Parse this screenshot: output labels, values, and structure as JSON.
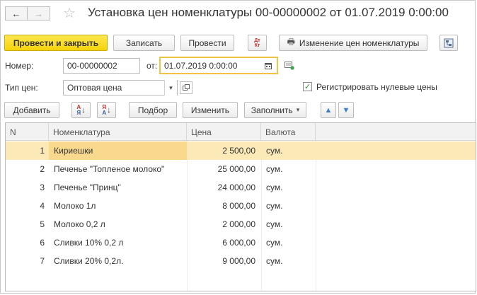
{
  "window": {
    "title": "Установка цен номенклатуры 00-00000002 от 01.07.2019 0:00:00",
    "nav": {
      "back": "←",
      "forward": "→"
    },
    "favorite_icon": "star-icon"
  },
  "toolbar": {
    "post_close": "Провести и закрыть",
    "save": "Записать",
    "post": "Провести",
    "dtkt_top": "Дт",
    "dtkt_bottom": "Кт",
    "print_label": "Изменение цен номенклатуры"
  },
  "form": {
    "number_label": "Номер:",
    "number_value": "00-00000002",
    "date_label": "от:",
    "date_value": "01.07.2019  0:00:00",
    "price_type_label": "Тип цен:",
    "price_type_value": "Оптовая цена",
    "zero_prices_label": "Регистрировать нулевые цены",
    "zero_prices_checked": true
  },
  "table_toolbar": {
    "add": "Добавить",
    "sort_asc_top": "А",
    "sort_asc_bottom": "Я",
    "sort_desc_top": "Я",
    "sort_desc_bottom": "А",
    "select": "Подбор",
    "change": "Изменить",
    "fill": "Заполнить",
    "fill_arrow": "▾",
    "up": "▲",
    "down": "▼"
  },
  "table": {
    "columns": [
      "N",
      "Номенклатура",
      "Цена",
      "Валюта"
    ],
    "rows": [
      {
        "n": "1",
        "name": "Кириешки",
        "price": "2 500,00",
        "currency": "сум."
      },
      {
        "n": "2",
        "name": "Печенье \"Топленое молоко\"",
        "price": "25 000,00",
        "currency": "сум."
      },
      {
        "n": "3",
        "name": "Печенье \"Принц\"",
        "price": "24 000,00",
        "currency": "сум."
      },
      {
        "n": "4",
        "name": "Молоко 1л",
        "price": "8 000,00",
        "currency": "сум."
      },
      {
        "n": "5",
        "name": "Молоко 0,2 л",
        "price": "2 000,00",
        "currency": "сум."
      },
      {
        "n": "6",
        "name": "Сливки 10%  0,2 л",
        "price": "6 000,00",
        "currency": "сум."
      },
      {
        "n": "7",
        "name": "Сливки 20% 0,2л.",
        "price": "9 000,00",
        "currency": "сум."
      }
    ],
    "selected_row": 0
  },
  "colors": {
    "primary_button": "#f5d30a",
    "selected_row": "#fbeab7",
    "focus_border": "#f0c342"
  }
}
